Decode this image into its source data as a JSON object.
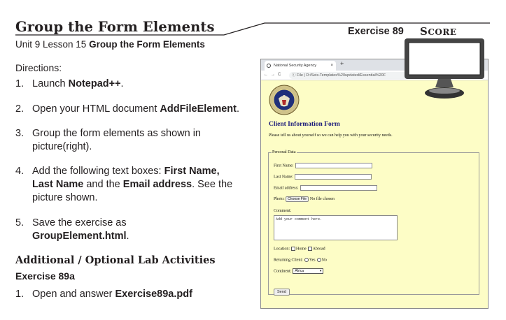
{
  "header": {
    "title": "Group the Form Elements",
    "exercise": "Exercise 89",
    "score_first": "S",
    "score_rest": "CORE"
  },
  "subtitle": {
    "prefix": "Unit 9 Lesson 15 ",
    "bold": "Group the Form Elements"
  },
  "directions_label": "Directions:",
  "steps": [
    {
      "num": "1.",
      "text_a": "Launch ",
      "bold_a": "Notepad++",
      "text_b": ".",
      "cont": ""
    },
    {
      "num": "2.",
      "text_a": "Open your HTML document ",
      "bold_a": "AddFileElement",
      "text_b": ".",
      "cont": ""
    },
    {
      "num": "3.",
      "text_a": "Group the form elements as shown in",
      "bold_a": "",
      "text_b": "",
      "cont": "picture(right)."
    },
    {
      "num": "4.",
      "text_a": "Add the following text boxes: ",
      "bold_a": "First Name,",
      "text_b": ""
    },
    {
      "num": "5.",
      "text_a": "Save the exercise as",
      "bold_a": "",
      "text_b": ""
    }
  ],
  "step4": {
    "bold1": "Last Name",
    "text1": " and the ",
    "bold2": "Email address",
    "text2": ". See the",
    "line3": "picture shown."
  },
  "step5": {
    "bold": "GroupElement.html",
    "text": "."
  },
  "additional": {
    "title": "Additional / Optional Lab Activities",
    "exercise": "Exercise 89a",
    "step_num": "1.",
    "step_text": "Open and answer ",
    "step_bold": "Exercise89a.pdf"
  },
  "browser": {
    "tab_title": "National Security Agency",
    "tab_close": "×",
    "new_tab": "+",
    "nav": "←→C",
    "url": "ⓘ File | D:/Seis-Templates%20updated/Essential%20F",
    "heading": "Client Information Form",
    "intro": "Please tell us about yourself so we can help you with your security needs.",
    "legend": "Personal Data",
    "first_name": "First Name:",
    "last_name": "Last Name:",
    "email": "Email address:",
    "photo": "Photo:",
    "choose_file": "Choose File",
    "no_file": "No file chosen",
    "comment": "Comment:",
    "comment_placeholder": "Add your comment here.",
    "location": "Location:",
    "home": "Home",
    "abroad": "Abroad",
    "returning": "Returning Client:",
    "yes": "Yes",
    "no": "No",
    "continent": "Continent:",
    "continent_value": "Africa",
    "send": "Send"
  },
  "colors": {
    "page_bg": "#fdfdc6",
    "heading": "#1a1a7a",
    "text": "#231f20"
  }
}
